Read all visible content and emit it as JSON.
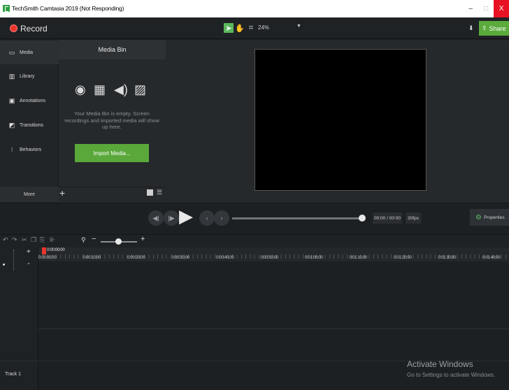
{
  "window": {
    "title": "TechSmith Camtasia 2019 (Not Responding)",
    "minimize": "–",
    "maximize": "□",
    "close": "X"
  },
  "toolbar": {
    "record_label": "Record",
    "zoom_value": "24%",
    "share_label": "Share"
  },
  "sidebar": {
    "items": [
      {
        "label": "Media",
        "icon": "media-icon"
      },
      {
        "label": "Library",
        "icon": "library-icon"
      },
      {
        "label": "Annotations",
        "icon": "annotations-icon"
      },
      {
        "label": "Transitions",
        "icon": "transitions-icon"
      },
      {
        "label": "Behaviors",
        "icon": "behaviors-icon"
      }
    ],
    "more_label": "More"
  },
  "media_bin": {
    "title": "Media Bin",
    "empty_text": "Your Media Bin is empty. Screen recordings and imported media will show up here.",
    "import_label": "Import Media..."
  },
  "playback": {
    "time": "00:00 / 00:00",
    "fps": "30fps",
    "properties_label": "Properties",
    "progress": 1.0
  },
  "timeline": {
    "playhead_time": "0:00:00;00",
    "ticks": [
      "0:00:00;00",
      "0:00:10;00",
      "0:00:20;00",
      "0:00:30;00",
      "0:00:40;00",
      "0:00:50;00",
      "0:01:00;00",
      "0:01:10;00",
      "0:01:20;00",
      "0:01:30;00",
      "0:01:40;00"
    ],
    "track_label": "Track 1"
  },
  "watermark": {
    "title": "Activate Windows",
    "subtitle": "Go to Settings to activate Windows."
  },
  "colors": {
    "accent": "#5aa83a",
    "record": "#e8352d",
    "close": "#e81123"
  }
}
